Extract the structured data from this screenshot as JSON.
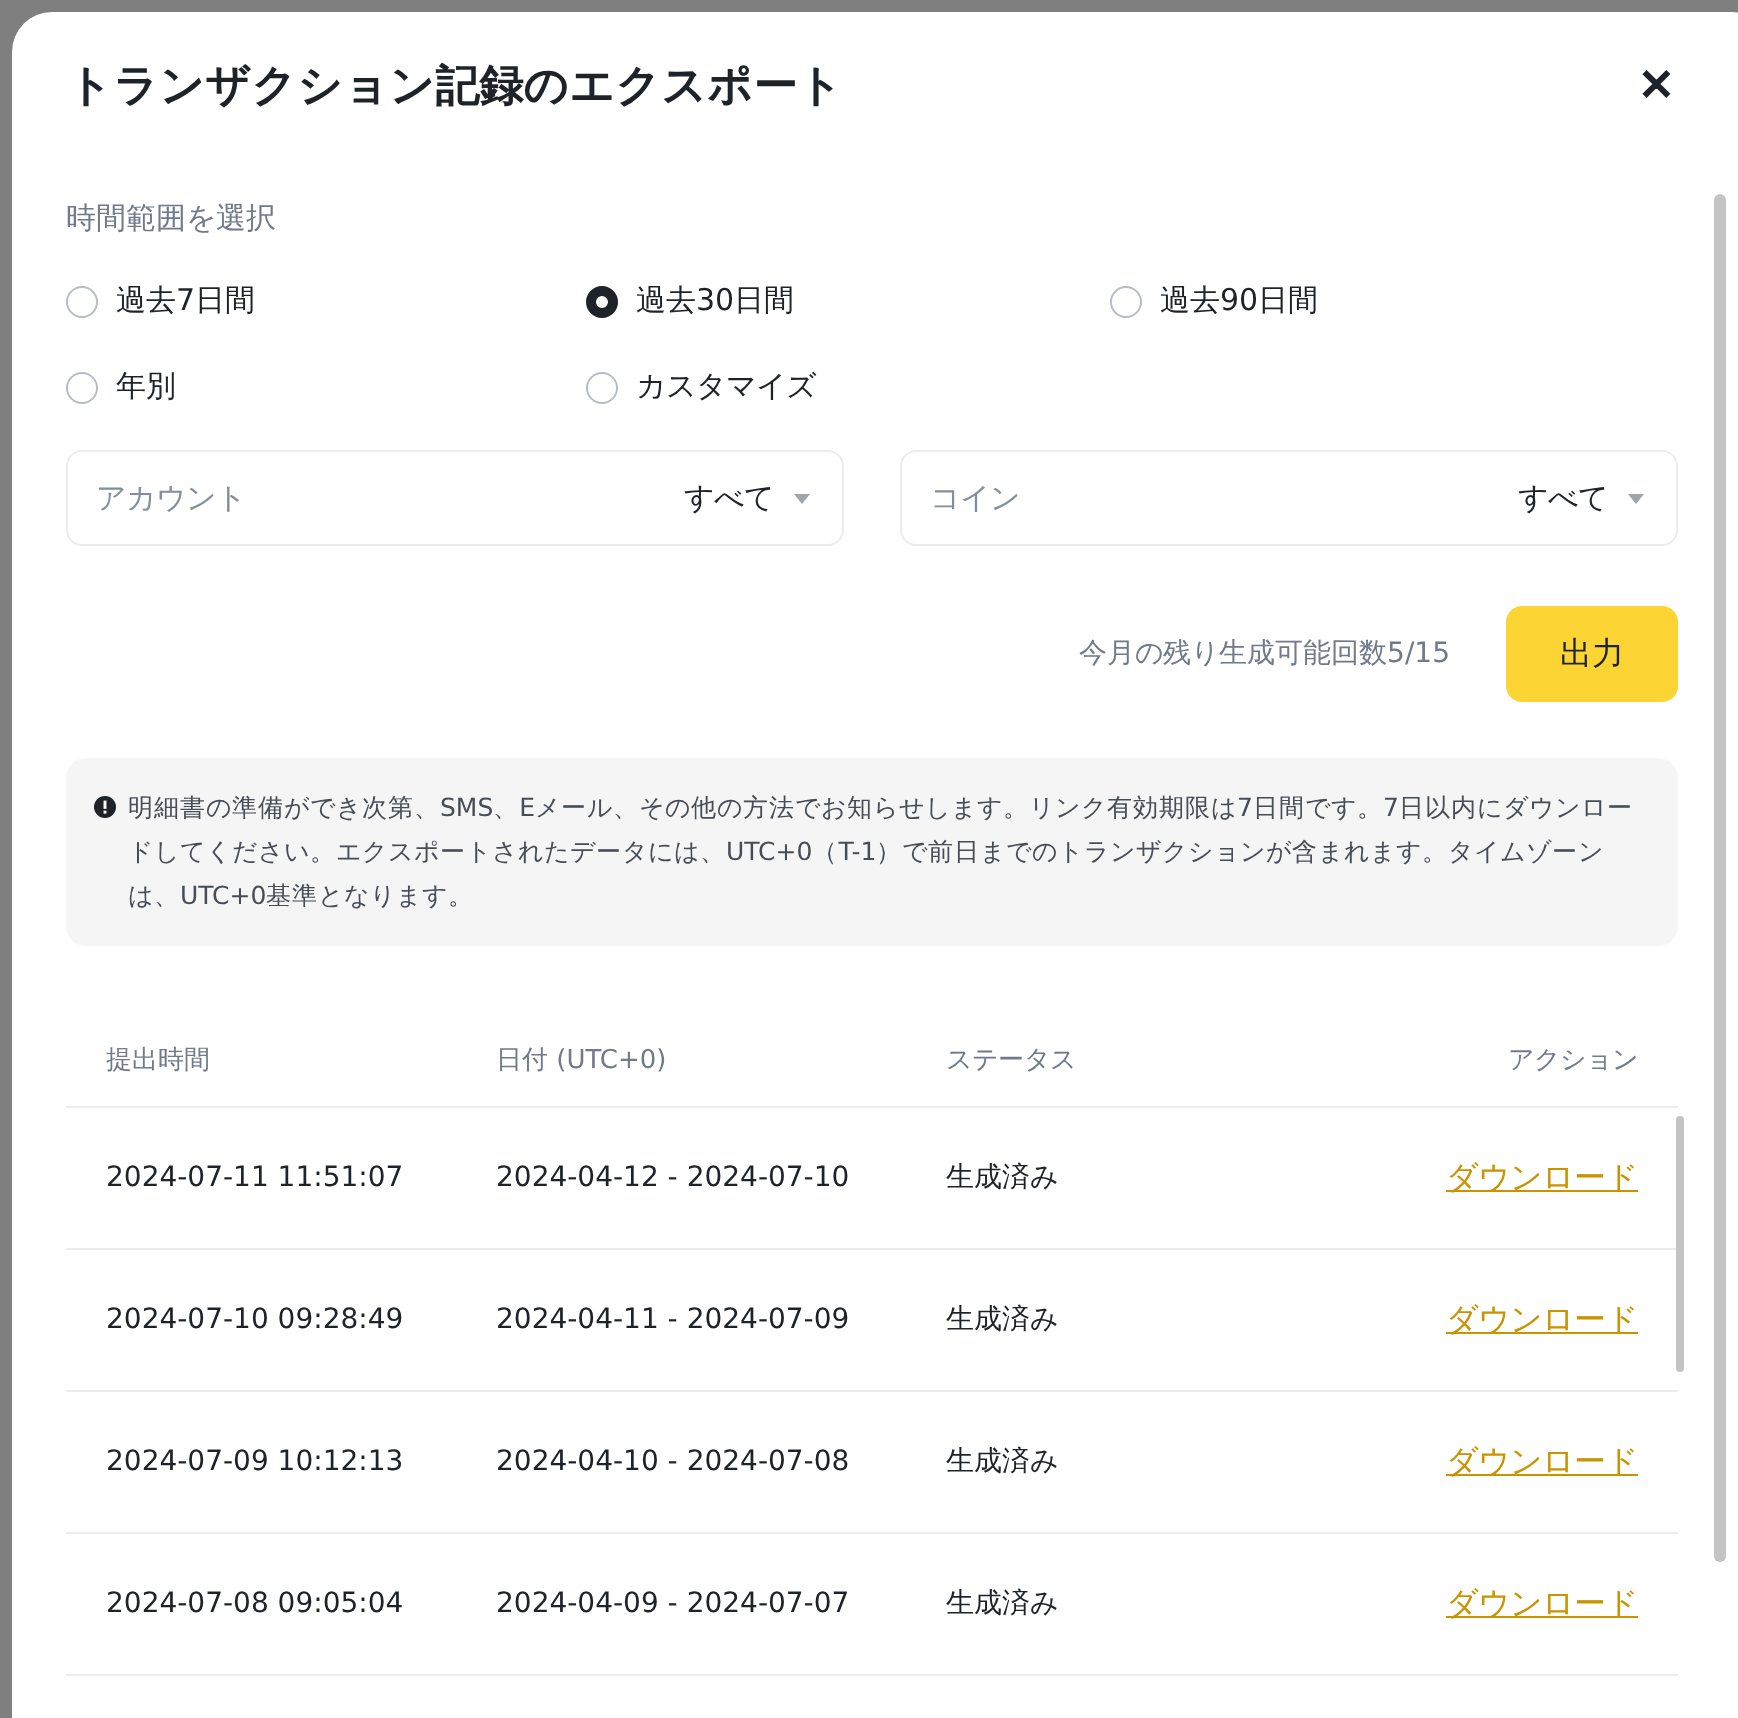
{
  "dialog": {
    "title": "トランザクション記録のエクスポート",
    "close": "✕"
  },
  "time_range": {
    "label": "時間範囲を選択",
    "options": [
      {
        "label": "過去7日間",
        "selected": false
      },
      {
        "label": "過去30日間",
        "selected": true
      },
      {
        "label": "過去90日間",
        "selected": false
      },
      {
        "label": "年別",
        "selected": false
      },
      {
        "label": "カスタマイズ",
        "selected": false
      }
    ]
  },
  "filters": [
    {
      "label": "アカウント",
      "value": "すべて"
    },
    {
      "label": "コイン",
      "value": "すべて"
    }
  ],
  "remaining": "今月の残り生成可能回数5/15",
  "export_button": "出力",
  "notice": "明細書の準備ができ次第、SMS、Eメール、その他の方法でお知らせします。リンク有効期限は7日間です。7日以内にダウンロードしてください。エクスポートされたデータには、UTC+0（T-1）で前日までのトランザクションが含まれます。タイムゾーンは、UTC+0基準となります。",
  "table": {
    "columns": [
      "提出時間",
      "日付 (UTC+0)",
      "ステータス",
      "アクション"
    ],
    "rows": [
      {
        "submitted": "2024-07-11 11:51:07",
        "range": "2024-04-12 - 2024-07-10",
        "status": "生成済み",
        "action": "ダウンロード"
      },
      {
        "submitted": "2024-07-10 09:28:49",
        "range": "2024-04-11 - 2024-07-09",
        "status": "生成済み",
        "action": "ダウンロード"
      },
      {
        "submitted": "2024-07-09 10:12:13",
        "range": "2024-04-10 - 2024-07-08",
        "status": "生成済み",
        "action": "ダウンロード"
      },
      {
        "submitted": "2024-07-08 09:05:04",
        "range": "2024-04-09 - 2024-07-07",
        "status": "生成済み",
        "action": "ダウンロード"
      }
    ]
  }
}
